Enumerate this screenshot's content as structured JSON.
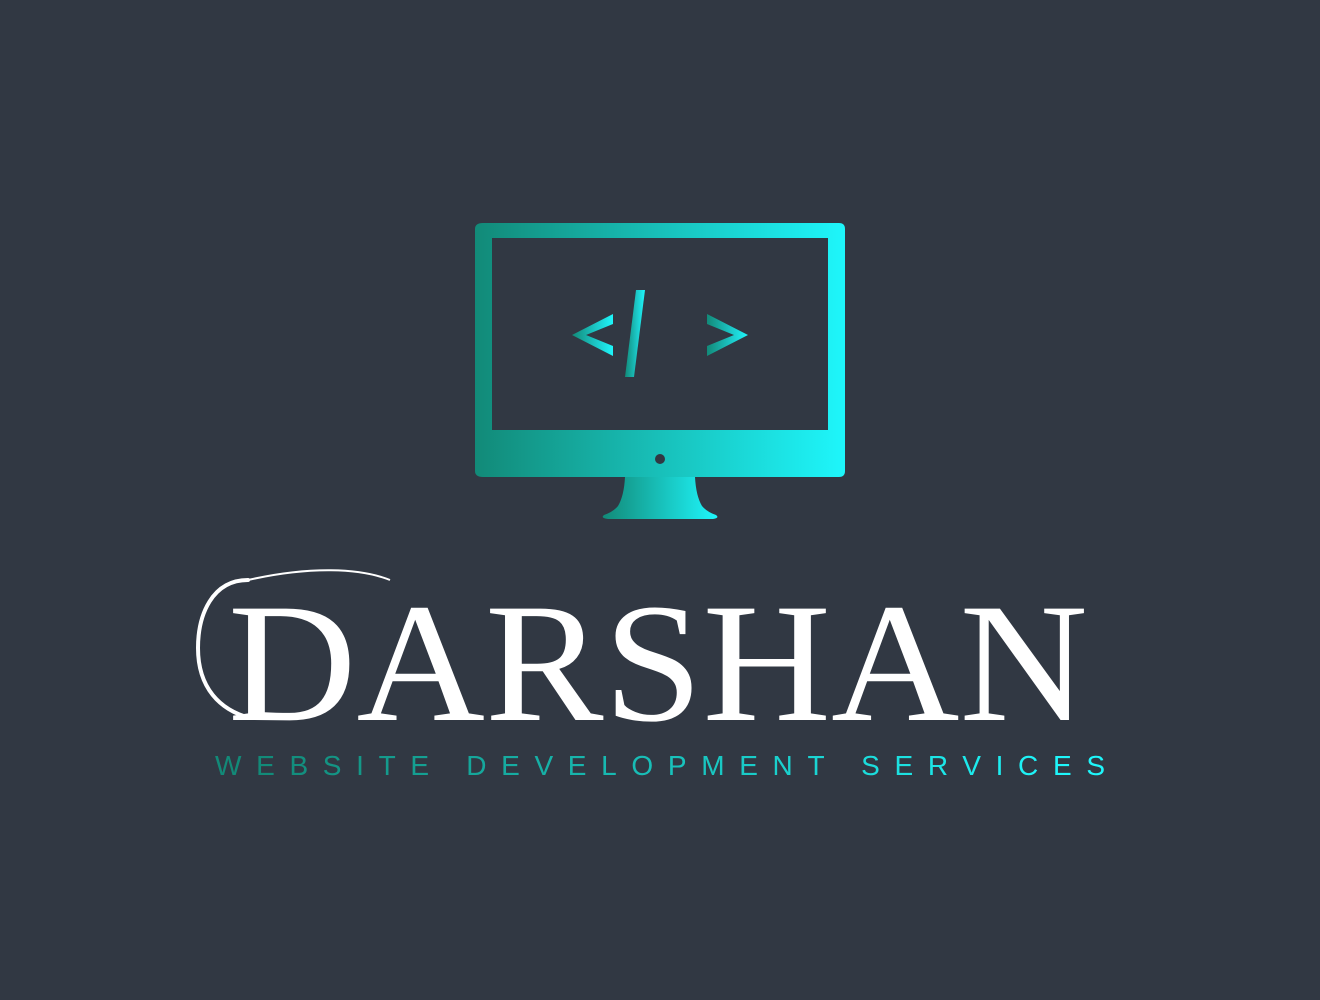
{
  "brand": {
    "name": "DARSHAN",
    "tagline": "WEBSITE DEVELOPMENT SERVICES",
    "code_symbol": "</>"
  },
  "colors": {
    "background": "#313843",
    "wordmark": "#ffffff",
    "gradient_start": "#128a78",
    "gradient_end": "#1ef6fb"
  },
  "icons": {
    "logo_icon": "monitor-code-icon"
  }
}
